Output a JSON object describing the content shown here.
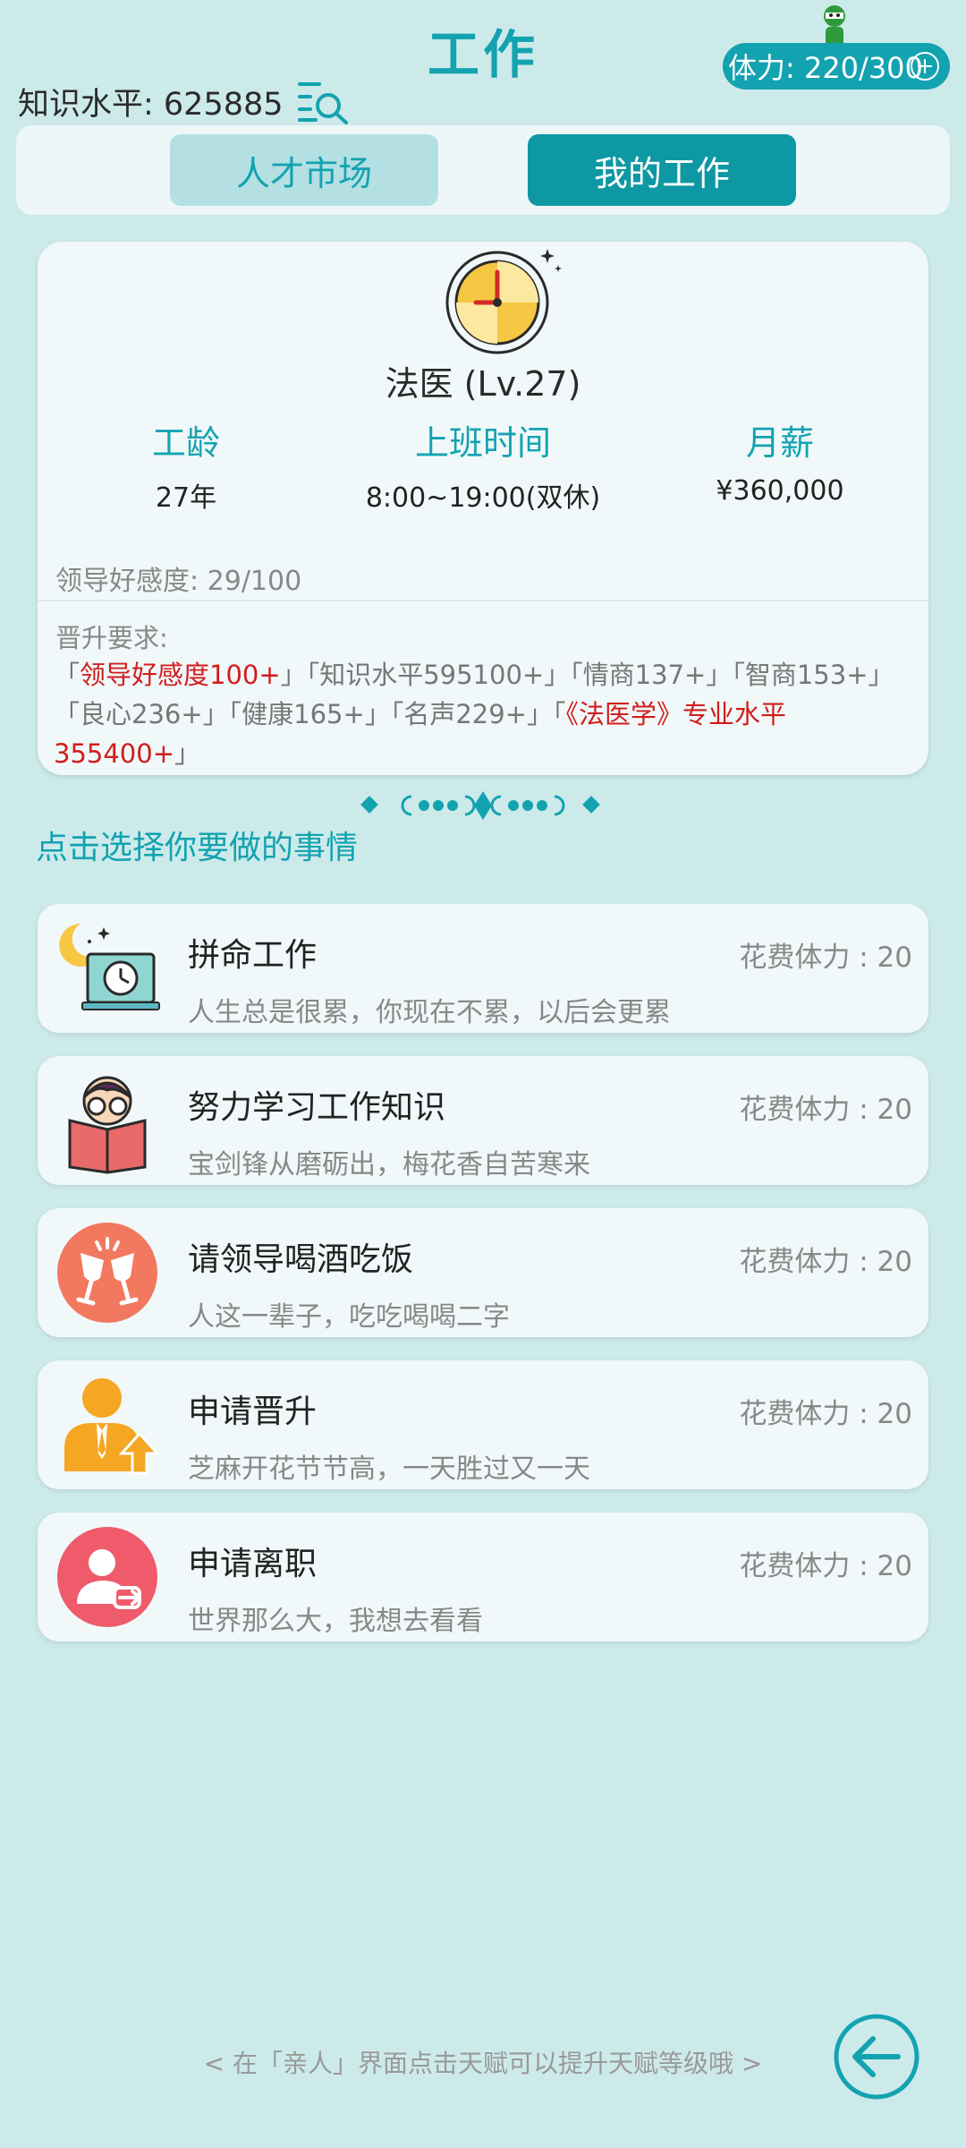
{
  "header": {
    "title": "工作",
    "knowledge_label": "知识水平: 625885",
    "stamina_label": "体力: 220/300"
  },
  "tabs": [
    {
      "label": "人才市场",
      "active": false
    },
    {
      "label": "我的工作",
      "active": true
    }
  ],
  "job": {
    "name": "法医 (Lv.27)",
    "stats": [
      {
        "label": "工龄",
        "value": "27年"
      },
      {
        "label": "上班时间",
        "value": "8:00~19:00(双休)"
      },
      {
        "label": "月薪",
        "value": "¥360,000"
      }
    ],
    "favor": "领导好感度: 29/100",
    "promotion_title": "晋升要求:",
    "promotion_parts": {
      "p1a": "「",
      "p1": "领导好感度100+",
      "p1b": "」",
      "p2": "「知识水平595100+」",
      "p3": "「情商137+」",
      "p4": "「智商153+」",
      "p5": "「良心236+」",
      "p6": "「健康165+」",
      "p7": "「名声229+」",
      "p8a": "「",
      "p8": "《法医学》专业水平355400+",
      "p8b": "」"
    }
  },
  "section_title": "点击选择你要做的事情",
  "actions": [
    {
      "title": "拼命工作",
      "cost": "花费体力 : 20",
      "desc": "人生总是很累，你现在不累，以后会更累",
      "icon": "overtime-clock-icon"
    },
    {
      "title": "努力学习工作知识",
      "cost": "花费体力 : 20",
      "desc": "宝剑锋从磨砺出，梅花香自苦寒来",
      "icon": "study-book-icon"
    },
    {
      "title": "请领导喝酒吃饭",
      "cost": "花费体力 : 20",
      "desc": "人这一辈子，吃吃喝喝二字",
      "icon": "wine-toast-icon"
    },
    {
      "title": "申请晋升",
      "cost": "花费体力 : 20",
      "desc": "芝麻开花节节高，一天胜过又一天",
      "icon": "promotion-person-icon"
    },
    {
      "title": "申请离职",
      "cost": "花费体力 : 20",
      "desc": "世界那么大，我想去看看",
      "icon": "resign-person-icon"
    }
  ],
  "footer": {
    "hint": "< 在「亲人」界面点击天赋可以提升天赋等级哦 >"
  },
  "colors": {
    "background": "#cdeaea",
    "accent": "#13a3b0",
    "highlight_red": "#d11d1d"
  }
}
